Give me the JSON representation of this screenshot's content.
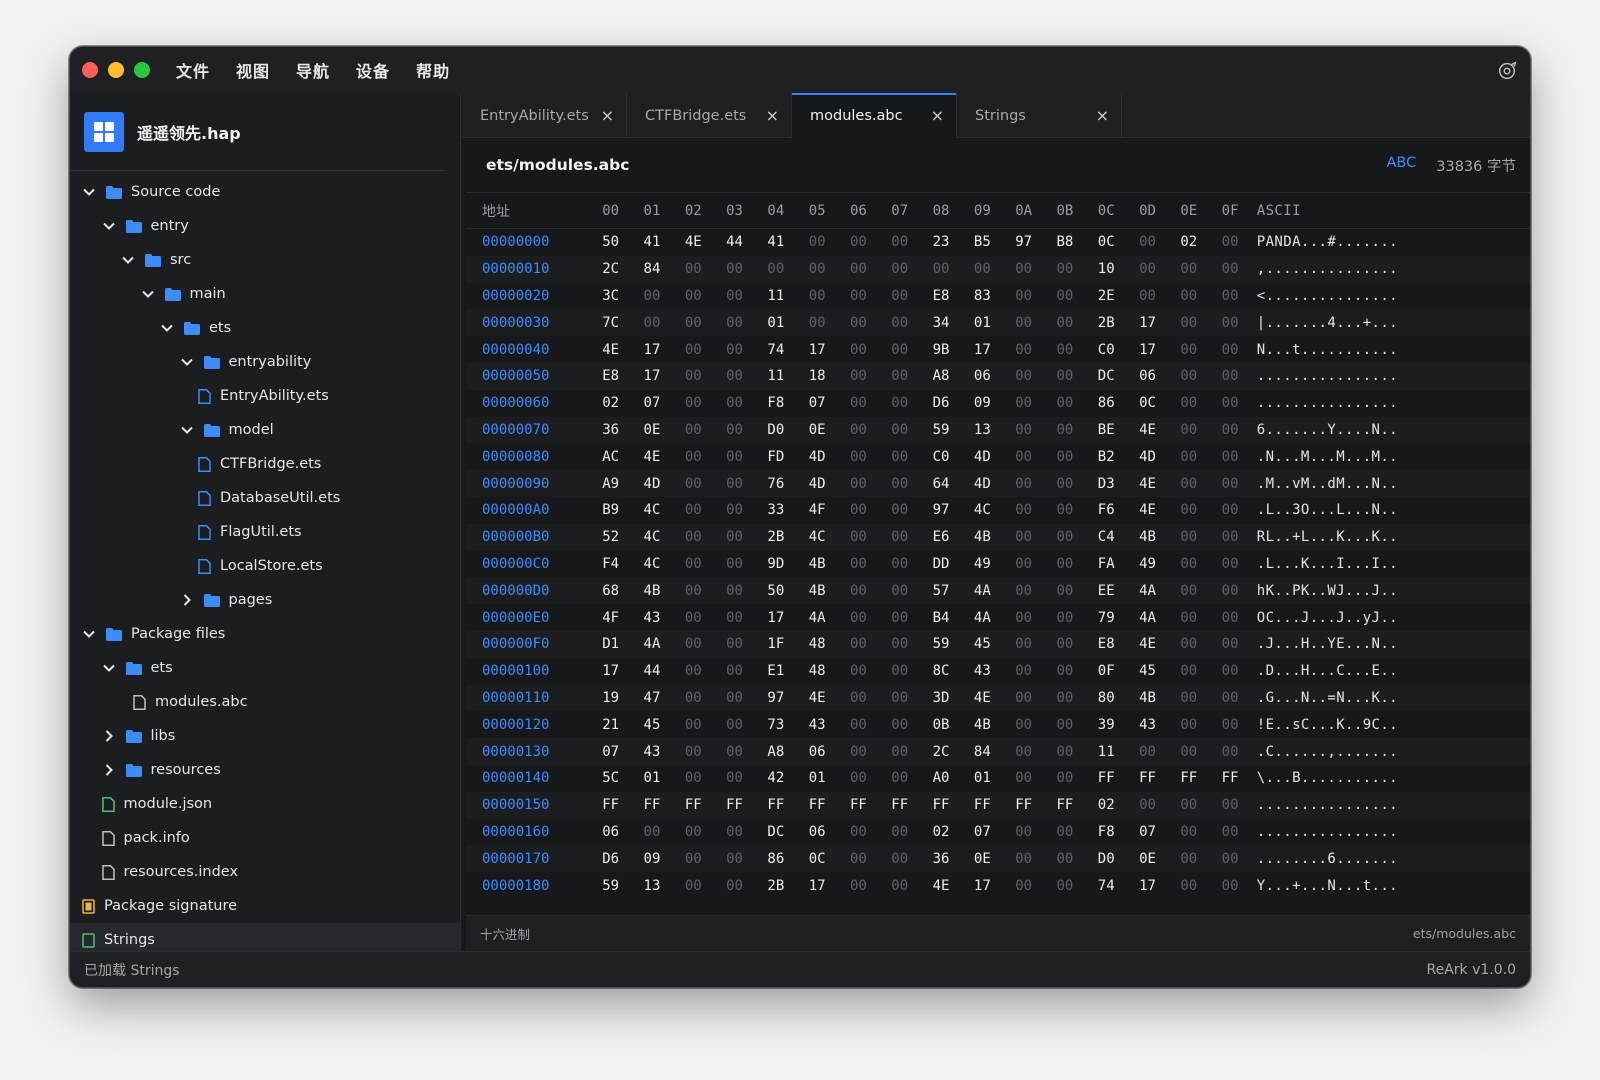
{
  "menu": [
    "文件",
    "视图",
    "导航",
    "设备",
    "帮助"
  ],
  "app": {
    "name": "遥遥领先.hap"
  },
  "tree": [
    {
      "label": "Source code",
      "type": "folder",
      "depth": 0,
      "expanded": true
    },
    {
      "label": "entry",
      "type": "folder",
      "depth": 1,
      "expanded": true
    },
    {
      "label": "src",
      "type": "folder",
      "depth": 2,
      "expanded": true
    },
    {
      "label": "main",
      "type": "folder",
      "depth": 3,
      "expanded": true
    },
    {
      "label": "ets",
      "type": "folder",
      "depth": 4,
      "expanded": true
    },
    {
      "label": "entryability",
      "type": "folder",
      "depth": 5,
      "expanded": true
    },
    {
      "label": "EntryAbility.ets",
      "type": "file",
      "depth": 6
    },
    {
      "label": "model",
      "type": "folder",
      "depth": 5,
      "expanded": true
    },
    {
      "label": "CTFBridge.ets",
      "type": "file",
      "depth": 6
    },
    {
      "label": "DatabaseUtil.ets",
      "type": "file",
      "depth": 6
    },
    {
      "label": "FlagUtil.ets",
      "type": "file",
      "depth": 6
    },
    {
      "label": "LocalStore.ets",
      "type": "file",
      "depth": 6
    },
    {
      "label": "pages",
      "type": "folder",
      "depth": 5,
      "expanded": false
    },
    {
      "label": "Package files",
      "type": "folder",
      "depth": 0,
      "expanded": true
    },
    {
      "label": "ets",
      "type": "folder",
      "depth": 1,
      "expanded": true
    },
    {
      "label": "modules.abc",
      "type": "plain-file",
      "depth": 2
    },
    {
      "label": "libs",
      "type": "folder",
      "depth": 1,
      "expanded": false
    },
    {
      "label": "resources",
      "type": "folder",
      "depth": 1,
      "expanded": false
    },
    {
      "label": "module.json",
      "type": "json-file",
      "depth": 1
    },
    {
      "label": "pack.info",
      "type": "plain-file",
      "depth": 1
    },
    {
      "label": "resources.index",
      "type": "plain-file",
      "depth": 1
    },
    {
      "label": "Package signature",
      "type": "signature",
      "depth": 0
    },
    {
      "label": "Strings",
      "type": "strings",
      "depth": 0
    }
  ],
  "tabs": [
    {
      "label": "EntryAbility.ets",
      "active": false
    },
    {
      "label": "CTFBridge.ets",
      "active": false
    },
    {
      "label": "modules.abc",
      "active": true
    },
    {
      "label": "Strings",
      "active": false
    }
  ],
  "tab_close_glyph": "×",
  "editor": {
    "path": "ets/modules.abc",
    "mode_badge": "ABC",
    "size": "33836 字节"
  },
  "hex": {
    "addr_header": "地址",
    "byte_headers": [
      "00",
      "01",
      "02",
      "03",
      "04",
      "05",
      "06",
      "07",
      "08",
      "09",
      "0A",
      "0B",
      "0C",
      "0D",
      "0E",
      "0F"
    ],
    "ascii_header": "ASCII",
    "rows": [
      {
        "addr": "00000000",
        "bytes": [
          "50",
          "41",
          "4E",
          "44",
          "41",
          "00",
          "00",
          "00",
          "23",
          "B5",
          "97",
          "B8",
          "0C",
          "00",
          "02",
          "00"
        ],
        "ascii": "PANDA...#......."
      },
      {
        "addr": "00000010",
        "bytes": [
          "2C",
          "84",
          "00",
          "00",
          "00",
          "00",
          "00",
          "00",
          "00",
          "00",
          "00",
          "00",
          "10",
          "00",
          "00",
          "00"
        ],
        "ascii": ",..............."
      },
      {
        "addr": "00000020",
        "bytes": [
          "3C",
          "00",
          "00",
          "00",
          "11",
          "00",
          "00",
          "00",
          "E8",
          "83",
          "00",
          "00",
          "2E",
          "00",
          "00",
          "00"
        ],
        "ascii": "<..............."
      },
      {
        "addr": "00000030",
        "bytes": [
          "7C",
          "00",
          "00",
          "00",
          "01",
          "00",
          "00",
          "00",
          "34",
          "01",
          "00",
          "00",
          "2B",
          "17",
          "00",
          "00"
        ],
        "ascii": "|.......4...+..."
      },
      {
        "addr": "00000040",
        "bytes": [
          "4E",
          "17",
          "00",
          "00",
          "74",
          "17",
          "00",
          "00",
          "9B",
          "17",
          "00",
          "00",
          "C0",
          "17",
          "00",
          "00"
        ],
        "ascii": "N...t..........."
      },
      {
        "addr": "00000050",
        "bytes": [
          "E8",
          "17",
          "00",
          "00",
          "11",
          "18",
          "00",
          "00",
          "A8",
          "06",
          "00",
          "00",
          "DC",
          "06",
          "00",
          "00"
        ],
        "ascii": "................"
      },
      {
        "addr": "00000060",
        "bytes": [
          "02",
          "07",
          "00",
          "00",
          "F8",
          "07",
          "00",
          "00",
          "D6",
          "09",
          "00",
          "00",
          "86",
          "0C",
          "00",
          "00"
        ],
        "ascii": "................"
      },
      {
        "addr": "00000070",
        "bytes": [
          "36",
          "0E",
          "00",
          "00",
          "D0",
          "0E",
          "00",
          "00",
          "59",
          "13",
          "00",
          "00",
          "BE",
          "4E",
          "00",
          "00"
        ],
        "ascii": "6.......Y....N.."
      },
      {
        "addr": "00000080",
        "bytes": [
          "AC",
          "4E",
          "00",
          "00",
          "FD",
          "4D",
          "00",
          "00",
          "C0",
          "4D",
          "00",
          "00",
          "B2",
          "4D",
          "00",
          "00"
        ],
        "ascii": ".N...M...M...M.."
      },
      {
        "addr": "00000090",
        "bytes": [
          "A9",
          "4D",
          "00",
          "00",
          "76",
          "4D",
          "00",
          "00",
          "64",
          "4D",
          "00",
          "00",
          "D3",
          "4E",
          "00",
          "00"
        ],
        "ascii": ".M..vM..dM...N.."
      },
      {
        "addr": "000000A0",
        "bytes": [
          "B9",
          "4C",
          "00",
          "00",
          "33",
          "4F",
          "00",
          "00",
          "97",
          "4C",
          "00",
          "00",
          "F6",
          "4E",
          "00",
          "00"
        ],
        "ascii": ".L..3O...L...N.."
      },
      {
        "addr": "000000B0",
        "bytes": [
          "52",
          "4C",
          "00",
          "00",
          "2B",
          "4C",
          "00",
          "00",
          "E6",
          "4B",
          "00",
          "00",
          "C4",
          "4B",
          "00",
          "00"
        ],
        "ascii": "RL..+L...K...K.."
      },
      {
        "addr": "000000C0",
        "bytes": [
          "F4",
          "4C",
          "00",
          "00",
          "9D",
          "4B",
          "00",
          "00",
          "DD",
          "49",
          "00",
          "00",
          "FA",
          "49",
          "00",
          "00"
        ],
        "ascii": ".L...K...I...I.."
      },
      {
        "addr": "000000D0",
        "bytes": [
          "68",
          "4B",
          "00",
          "00",
          "50",
          "4B",
          "00",
          "00",
          "57",
          "4A",
          "00",
          "00",
          "EE",
          "4A",
          "00",
          "00"
        ],
        "ascii": "hK..PK..WJ...J.."
      },
      {
        "addr": "000000E0",
        "bytes": [
          "4F",
          "43",
          "00",
          "00",
          "17",
          "4A",
          "00",
          "00",
          "B4",
          "4A",
          "00",
          "00",
          "79",
          "4A",
          "00",
          "00"
        ],
        "ascii": "OC...J...J..yJ.."
      },
      {
        "addr": "000000F0",
        "bytes": [
          "D1",
          "4A",
          "00",
          "00",
          "1F",
          "48",
          "00",
          "00",
          "59",
          "45",
          "00",
          "00",
          "E8",
          "4E",
          "00",
          "00"
        ],
        "ascii": ".J...H..YE...N.."
      },
      {
        "addr": "00000100",
        "bytes": [
          "17",
          "44",
          "00",
          "00",
          "E1",
          "48",
          "00",
          "00",
          "8C",
          "43",
          "00",
          "00",
          "0F",
          "45",
          "00",
          "00"
        ],
        "ascii": ".D...H...C...E.."
      },
      {
        "addr": "00000110",
        "bytes": [
          "19",
          "47",
          "00",
          "00",
          "97",
          "4E",
          "00",
          "00",
          "3D",
          "4E",
          "00",
          "00",
          "80",
          "4B",
          "00",
          "00"
        ],
        "ascii": ".G...N..=N...K.."
      },
      {
        "addr": "00000120",
        "bytes": [
          "21",
          "45",
          "00",
          "00",
          "73",
          "43",
          "00",
          "00",
          "0B",
          "4B",
          "00",
          "00",
          "39",
          "43",
          "00",
          "00"
        ],
        "ascii": "!E..sC...K..9C.."
      },
      {
        "addr": "00000130",
        "bytes": [
          "07",
          "43",
          "00",
          "00",
          "A8",
          "06",
          "00",
          "00",
          "2C",
          "84",
          "00",
          "00",
          "11",
          "00",
          "00",
          "00"
        ],
        "ascii": ".C......,......."
      },
      {
        "addr": "00000140",
        "bytes": [
          "5C",
          "01",
          "00",
          "00",
          "42",
          "01",
          "00",
          "00",
          "A0",
          "01",
          "00",
          "00",
          "FF",
          "FF",
          "FF",
          "FF"
        ],
        "ascii": "\\...B..........."
      },
      {
        "addr": "00000150",
        "bytes": [
          "FF",
          "FF",
          "FF",
          "FF",
          "FF",
          "FF",
          "FF",
          "FF",
          "FF",
          "FF",
          "FF",
          "FF",
          "02",
          "00",
          "00",
          "00"
        ],
        "ascii": "................"
      },
      {
        "addr": "00000160",
        "bytes": [
          "06",
          "00",
          "00",
          "00",
          "DC",
          "06",
          "00",
          "00",
          "02",
          "07",
          "00",
          "00",
          "F8",
          "07",
          "00",
          "00"
        ],
        "ascii": "................"
      },
      {
        "addr": "00000170",
        "bytes": [
          "D6",
          "09",
          "00",
          "00",
          "86",
          "0C",
          "00",
          "00",
          "36",
          "0E",
          "00",
          "00",
          "D0",
          "0E",
          "00",
          "00"
        ],
        "ascii": "........6......."
      },
      {
        "addr": "00000180",
        "bytes": [
          "59",
          "13",
          "00",
          "00",
          "2B",
          "17",
          "00",
          "00",
          "4E",
          "17",
          "00",
          "00",
          "74",
          "17",
          "00",
          "00"
        ],
        "ascii": "Y...+...N...t..."
      }
    ],
    "footer_mode": "十六进制",
    "footer_path": "ets/modules.abc"
  },
  "status": {
    "left": "已加载 Strings",
    "right": "ReArk v1.0.0"
  },
  "colors": {
    "accent": "#3d8cf7",
    "folder": "#3d8cf7",
    "traffic_red": "#fe5f57",
    "traffic_yellow": "#febc2e",
    "traffic_green": "#28c840"
  }
}
